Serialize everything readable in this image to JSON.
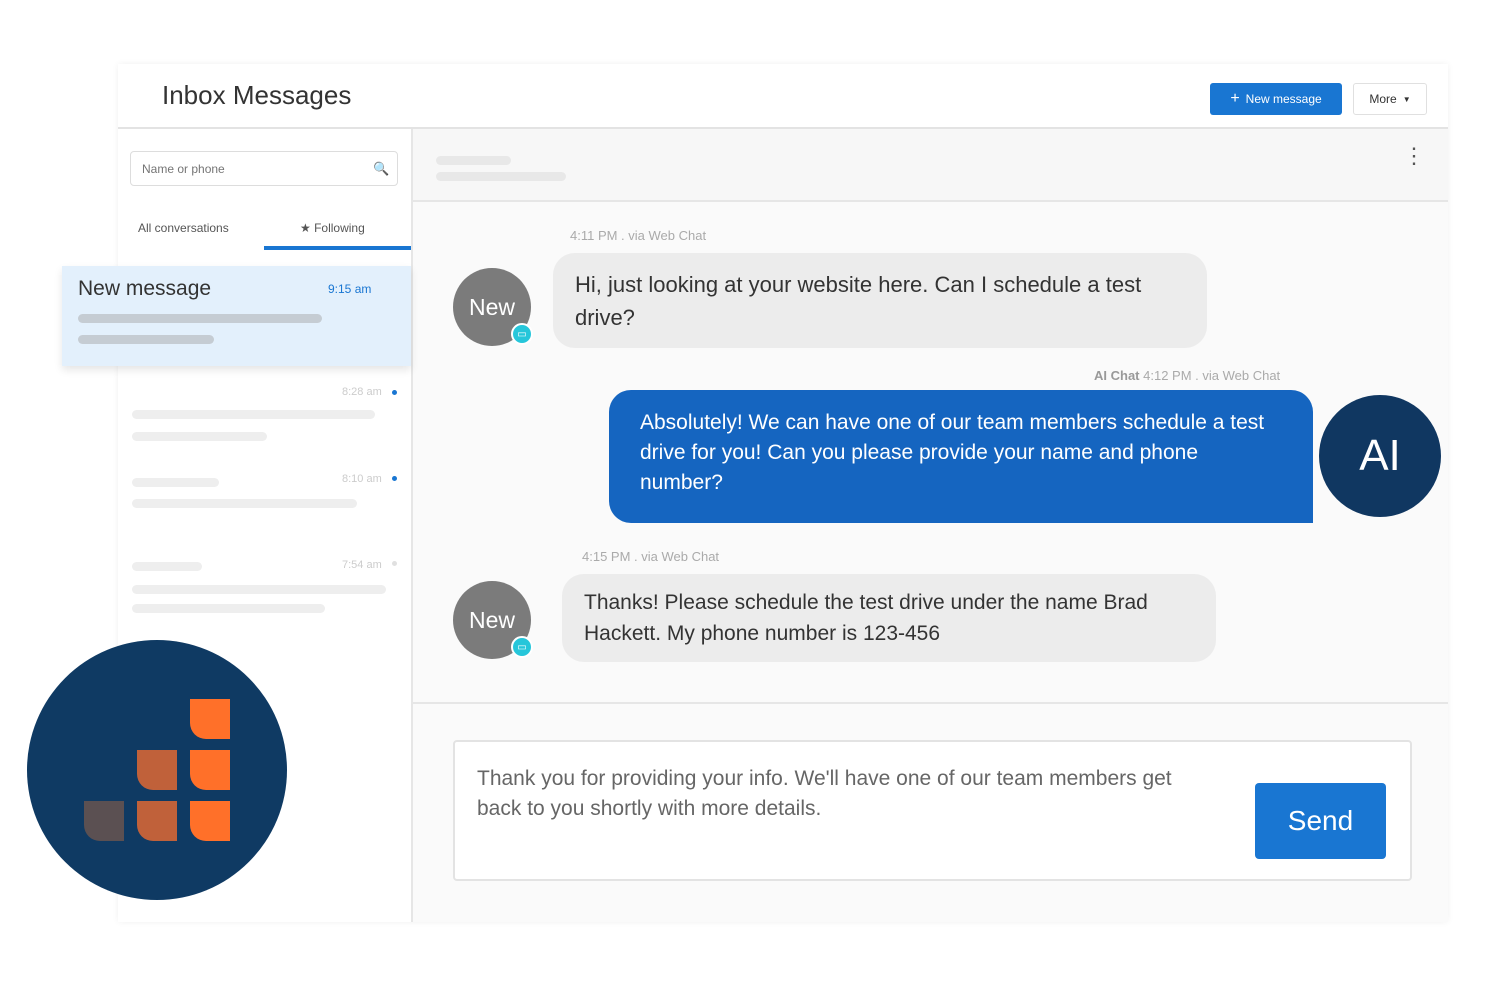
{
  "header": {
    "title": "Inbox Messages",
    "new_message_label": "New message",
    "more_label": "More"
  },
  "sidebar": {
    "search_placeholder": "Name or phone",
    "tabs": [
      {
        "label": "All conversations"
      },
      {
        "label": "Following",
        "active": true
      }
    ],
    "conversations": [
      {
        "title": "New message",
        "time": "9:15 am",
        "selected": true
      },
      {
        "time": "8:28 am",
        "unread": true
      },
      {
        "time": "8:10 am",
        "unread": true
      },
      {
        "time": "7:54 am",
        "unread": false
      }
    ]
  },
  "chat": {
    "messages": [
      {
        "meta": "4:11 PM . via Web Chat",
        "avatar": "New",
        "text": "Hi, just looking at your website here. Can I schedule a test drive?"
      },
      {
        "sender": "AI Chat",
        "meta": "4:12 PM . via Web Chat",
        "avatar": "AI",
        "text": "Absolutely! We can have one of our team members schedule a test drive for you! Can you please provide your name and phone number?"
      },
      {
        "meta": "4:15 PM . via Web Chat",
        "avatar": "New",
        "text": "Thanks! Please schedule the test drive under the name Brad Hackett. My phone number is 123-456"
      }
    ],
    "composer_text": "Thank you for providing your info. We'll have one of our team members get back to you shortly with more details.",
    "send_label": "Send"
  },
  "colors": {
    "accent": "#1976d2",
    "ai_bubble": "#1565c0",
    "logo_bg": "#0f3a63",
    "logo_orange": "#ff7029",
    "logo_rust": "#c0613a"
  }
}
